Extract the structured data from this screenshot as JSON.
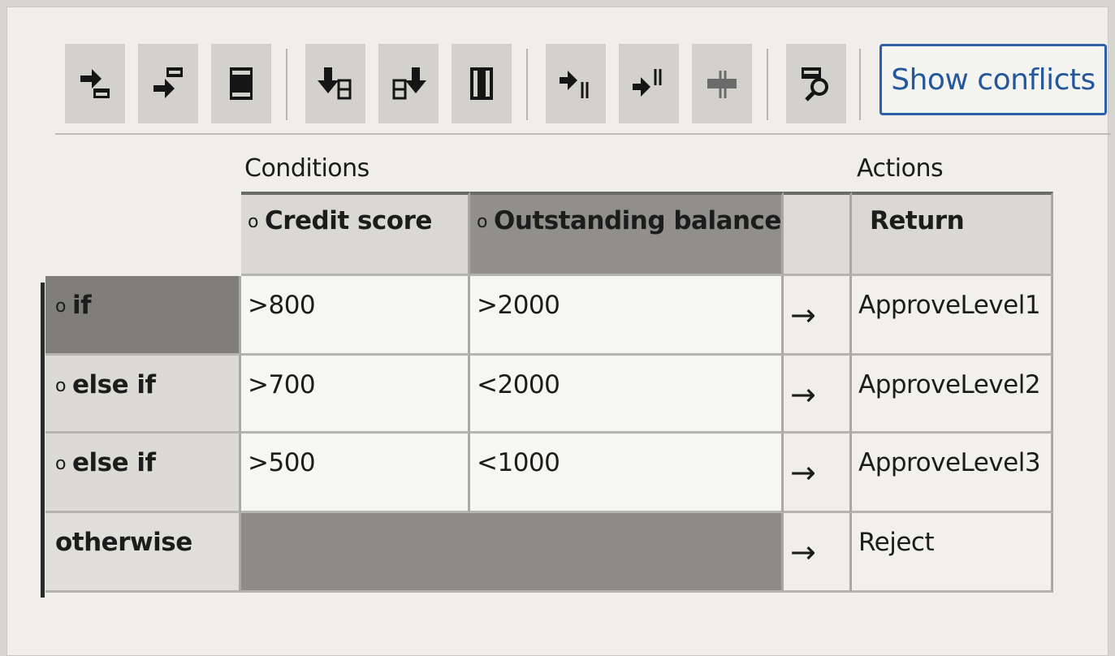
{
  "toolbar": {
    "buttons": [
      {
        "icon": "insert-row-above-icon"
      },
      {
        "icon": "insert-row-below-icon"
      },
      {
        "icon": "delete-row-icon"
      },
      {
        "icon": "insert-column-before-icon"
      },
      {
        "icon": "insert-column-after-icon"
      },
      {
        "icon": "delete-column-icon"
      },
      {
        "icon": "insert-action-before-icon"
      },
      {
        "icon": "insert-action-after-icon"
      },
      {
        "icon": "delete-action-icon"
      },
      {
        "icon": "find-table-icon"
      }
    ],
    "show_conflicts_label": "Show conflicts"
  },
  "sections": {
    "conditions_label": "Conditions",
    "actions_label": "Actions"
  },
  "columns": {
    "credit_score": "Credit score",
    "outstanding_balance": "Outstanding balance",
    "return": "Return",
    "bullet": "o"
  },
  "rows": [
    {
      "label": "if",
      "credit": ">800",
      "balance": ">2000",
      "arrow": "→",
      "action": "ApproveLevel1"
    },
    {
      "label": "else if",
      "credit": ">700",
      "balance": "<2000",
      "arrow": "→",
      "action": "ApproveLevel2"
    },
    {
      "label": "else if",
      "credit": ">500",
      "balance": "<1000",
      "arrow": "→",
      "action": "ApproveLevel3"
    },
    {
      "label": "otherwise",
      "arrow": "→",
      "action": "Reject"
    }
  ],
  "colors": {
    "accent": "#2d5fa6",
    "selected_header": "#908f8b",
    "selected_row": "#7f7e7a"
  }
}
